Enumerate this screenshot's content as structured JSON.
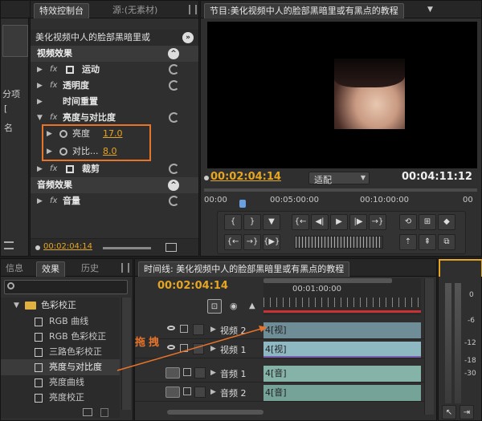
{
  "left_edge": {
    "label1": "分项",
    "label2": "[",
    "label3": "名"
  },
  "effect_controls": {
    "tabs": [
      "特效控制台",
      "源:(无素材)"
    ],
    "title": "美化视频中人的脸部黑暗里或",
    "video_section": "视频效果",
    "motion": "运动",
    "opacity": "透明度",
    "time_remap": "时间重置",
    "brightness_contrast": "亮度与对比度",
    "brightness_label": "亮度",
    "brightness_value": "17.0",
    "contrast_label": "对比...",
    "contrast_value": "8.0",
    "crop": "裁剪",
    "audio_section": "音频效果",
    "volume": "音量",
    "timecode": "00:02:04:14",
    "fx_label": "fx"
  },
  "program_monitor": {
    "title": "节目:美化视频中人的脸部黑暗里或有黑点的教程",
    "current_time": "00:02:04:14",
    "fit": "适配",
    "duration": "00:04:11:12",
    "ruler": [
      "00:00",
      "00:05:00:00",
      "00:10:00:00",
      "00"
    ]
  },
  "effects_panel": {
    "tabs": [
      "信息",
      "效果",
      "历史"
    ],
    "search_placeholder": "",
    "folder": "色彩校正",
    "items": [
      "RGB 曲线",
      "RGB 色彩校正",
      "三路色彩校正",
      "亮度与对比度",
      "亮度曲线",
      "亮度校正"
    ]
  },
  "timeline": {
    "title": "时间线: 美化视频中人的脸部黑暗里或有黑点的教程",
    "timecode": "00:02:04:14",
    "ruler_label": "00:01:00:00",
    "tracks": [
      {
        "name": "视频 2",
        "clip": "[视]"
      },
      {
        "name": "视频 1",
        "clip": "[视]"
      },
      {
        "name": "音频 1",
        "clip": "[音]"
      },
      {
        "name": "音频 2",
        "clip": "[音]"
      }
    ],
    "clip_prefix": "4"
  },
  "annotation": {
    "drag_label": "拖拽",
    "color": "#e8742a"
  },
  "audio_meter": {
    "labels": [
      "0",
      "-6",
      "-12",
      "-18",
      "-30"
    ]
  }
}
